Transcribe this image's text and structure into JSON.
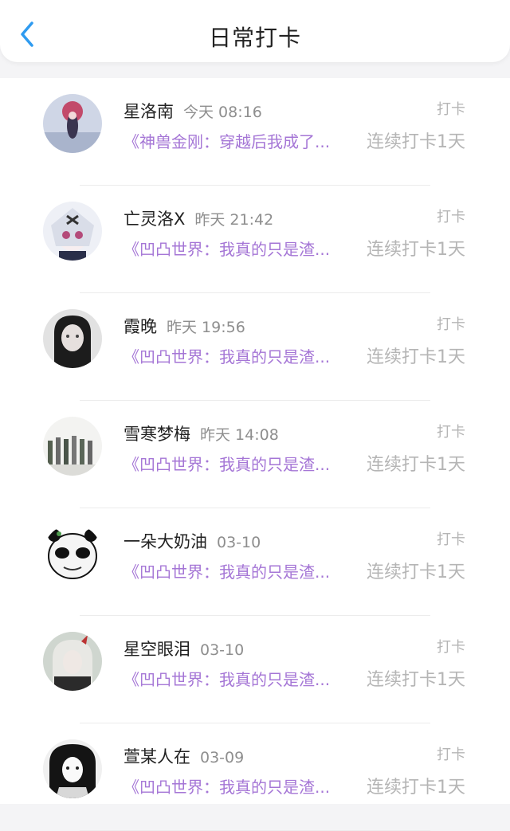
{
  "header": {
    "title": "日常打卡",
    "back_icon": "chevron-left-icon"
  },
  "colors": {
    "accent_blue": "#2f9bf0",
    "book_purple": "#a576d6",
    "muted": "#b5b5b5"
  },
  "items": [
    {
      "name": "星洛南",
      "time": "今天 08:16",
      "tag": "打卡",
      "book": "《神兽金刚：穿越后我成了...",
      "streak": "连续打卡1天"
    },
    {
      "name": "亡灵洛X",
      "time": "昨天 21:42",
      "tag": "打卡",
      "book": "《凹凸世界：我真的只是渣...",
      "streak": "连续打卡1天"
    },
    {
      "name": "霞晚",
      "time": "昨天 19:56",
      "tag": "打卡",
      "book": "《凹凸世界：我真的只是渣...",
      "streak": "连续打卡1天"
    },
    {
      "name": "雪寒梦梅",
      "time": "昨天 14:08",
      "tag": "打卡",
      "book": "《凹凸世界：我真的只是渣...",
      "streak": "连续打卡1天"
    },
    {
      "name": "一朵大奶油",
      "time": "03-10",
      "tag": "打卡",
      "book": "《凹凸世界：我真的只是渣...",
      "streak": "连续打卡1天"
    },
    {
      "name": "星空眼泪",
      "time": "03-10",
      "tag": "打卡",
      "book": "《凹凸世界：我真的只是渣...",
      "streak": "连续打卡1天"
    },
    {
      "name": "萱某人在",
      "time": "03-09",
      "tag": "打卡",
      "book": "《凹凸世界：我真的只是渣...",
      "streak": "连续打卡1天"
    }
  ]
}
